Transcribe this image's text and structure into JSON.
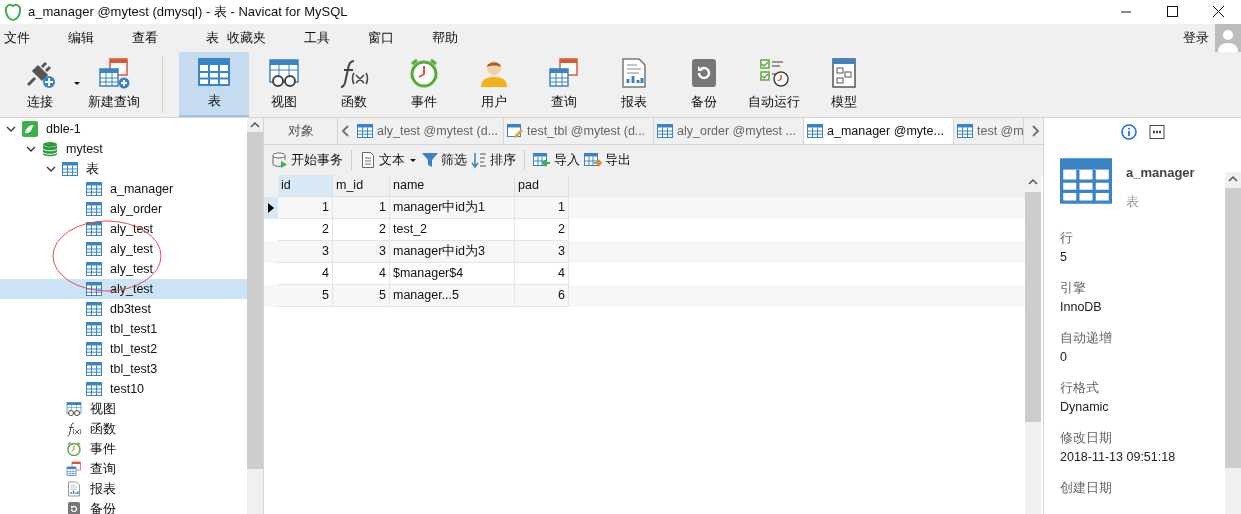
{
  "window": {
    "title": "a_manager @mytest (dmysql) - 表 - Navicat for MySQL"
  },
  "menu": [
    "文件",
    "编辑",
    "查看",
    "表",
    "收藏夹",
    "工具",
    "窗口",
    "帮助"
  ],
  "login": "登录",
  "toolbar": [
    {
      "kind": "connect",
      "label": "连接",
      "selected": false,
      "dropdown": true
    },
    {
      "kind": "new-query",
      "label": "新建查询",
      "selected": false,
      "dropdown": false
    },
    {
      "kind": "table",
      "label": "表",
      "selected": true,
      "dropdown": false
    },
    {
      "kind": "view",
      "label": "视图",
      "selected": false,
      "dropdown": false
    },
    {
      "kind": "function",
      "label": "函数",
      "selected": false,
      "dropdown": false
    },
    {
      "kind": "event",
      "label": "事件",
      "selected": false,
      "dropdown": false
    },
    {
      "kind": "user",
      "label": "用户",
      "selected": false,
      "dropdown": false
    },
    {
      "kind": "query",
      "label": "查询",
      "selected": false,
      "dropdown": false
    },
    {
      "kind": "report",
      "label": "报表",
      "selected": false,
      "dropdown": false
    },
    {
      "kind": "backup",
      "label": "备份",
      "selected": false,
      "dropdown": false
    },
    {
      "kind": "schedule",
      "label": "自动运行",
      "selected": false,
      "dropdown": false
    },
    {
      "kind": "model",
      "label": "模型",
      "selected": false,
      "dropdown": false
    }
  ],
  "tree": [
    {
      "kind": "connection",
      "label": "dble-1",
      "expanded": true,
      "selected": false,
      "children": [
        {
          "kind": "database",
          "label": "mytest",
          "expanded": true,
          "selected": false,
          "children": [
            {
              "kind": "table-group",
              "label": "表",
              "expanded": true,
              "selected": false,
              "children": [
                {
                  "kind": "table",
                  "label": "a_manager",
                  "selected": false
                },
                {
                  "kind": "table",
                  "label": "aly_order",
                  "selected": false
                },
                {
                  "kind": "table",
                  "label": "aly_test",
                  "selected": false
                },
                {
                  "kind": "table",
                  "label": "aly_test",
                  "selected": false
                },
                {
                  "kind": "table",
                  "label": "aly_test",
                  "selected": false
                },
                {
                  "kind": "table",
                  "label": "aly_test",
                  "selected": true
                },
                {
                  "kind": "table",
                  "label": "db3test",
                  "selected": false
                },
                {
                  "kind": "table",
                  "label": "tbl_test1",
                  "selected": false
                },
                {
                  "kind": "table",
                  "label": "tbl_test2",
                  "selected": false
                },
                {
                  "kind": "table",
                  "label": "tbl_test3",
                  "selected": false
                },
                {
                  "kind": "table",
                  "label": "test10",
                  "selected": false
                }
              ]
            },
            {
              "kind": "view",
              "label": "视图",
              "selected": false
            },
            {
              "kind": "function",
              "label": "函数",
              "selected": false
            },
            {
              "kind": "event",
              "label": "事件",
              "selected": false
            },
            {
              "kind": "query",
              "label": "查询",
              "selected": false
            },
            {
              "kind": "report",
              "label": "报表",
              "selected": false
            },
            {
              "kind": "backup",
              "label": "备份",
              "selected": false
            }
          ]
        }
      ]
    }
  ],
  "objects_tab": "对象",
  "tabs": [
    {
      "kind": "table",
      "label": "aly_test @mytest (d...",
      "selected": false
    },
    {
      "kind": "table-edit",
      "label": "test_tbl @mytest (d...",
      "selected": false
    },
    {
      "kind": "table",
      "label": "aly_order @mytest ...",
      "selected": false
    },
    {
      "kind": "table",
      "label": "a_manager @myte...",
      "selected": true
    },
    {
      "kind": "table",
      "label": "test @m",
      "selected": false
    }
  ],
  "actions": [
    {
      "kind": "transaction",
      "label": "开始事务",
      "dropdown": false
    },
    {
      "kind": "text",
      "label": "文本",
      "dropdown": true
    },
    {
      "kind": "filter",
      "label": "筛选",
      "dropdown": false
    },
    {
      "kind": "sort",
      "label": "排序",
      "dropdown": false
    },
    {
      "kind": "import",
      "label": "导入",
      "dropdown": false
    },
    {
      "kind": "export",
      "label": "导出",
      "dropdown": false
    }
  ],
  "table": {
    "columns": [
      "id",
      "m_id",
      "name",
      "pad"
    ],
    "rows": [
      {
        "current": true,
        "cells": [
          "1",
          "1",
          "manager中id为1",
          "1"
        ]
      },
      {
        "current": false,
        "cells": [
          "2",
          "2",
          "test_2",
          "2"
        ]
      },
      {
        "current": false,
        "cells": [
          "3",
          "3",
          "manager中id为3",
          "3"
        ]
      },
      {
        "current": false,
        "cells": [
          "4",
          "4",
          "$manager$4",
          "4"
        ]
      },
      {
        "current": false,
        "cells": [
          "5",
          "5",
          "manager...5",
          "6"
        ]
      }
    ]
  },
  "info": {
    "name": "a_manager",
    "type": "表",
    "properties": [
      {
        "label": "行",
        "value": "5"
      },
      {
        "label": "引擎",
        "value": "InnoDB"
      },
      {
        "label": "自动递增",
        "value": "0"
      },
      {
        "label": "行格式",
        "value": "Dynamic"
      },
      {
        "label": "修改日期",
        "value": "2018-11-13 09:51:18"
      },
      {
        "label": "创建日期"
      }
    ]
  }
}
